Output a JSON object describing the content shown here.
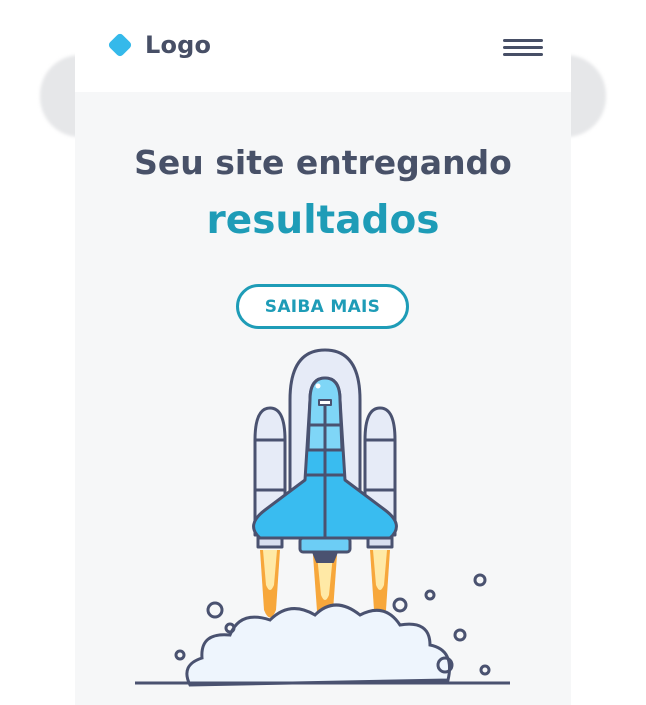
{
  "header": {
    "logo_text": "Logo",
    "logo_icon": "diamond-logo-icon",
    "menu_icon": "hamburger-menu-icon"
  },
  "hero": {
    "title": "Seu site entregando",
    "highlight": "resultados",
    "cta_label": "SAIBA MAIS",
    "illustration": "rocket-launch-illustration"
  },
  "colors": {
    "accent": "#1e9cb7",
    "text_dark": "#485168",
    "logo_blue": "#35b9ea",
    "background": "#f6f7f8",
    "rocket_blue": "#39bcf0",
    "flame_orange": "#f7a73b"
  }
}
